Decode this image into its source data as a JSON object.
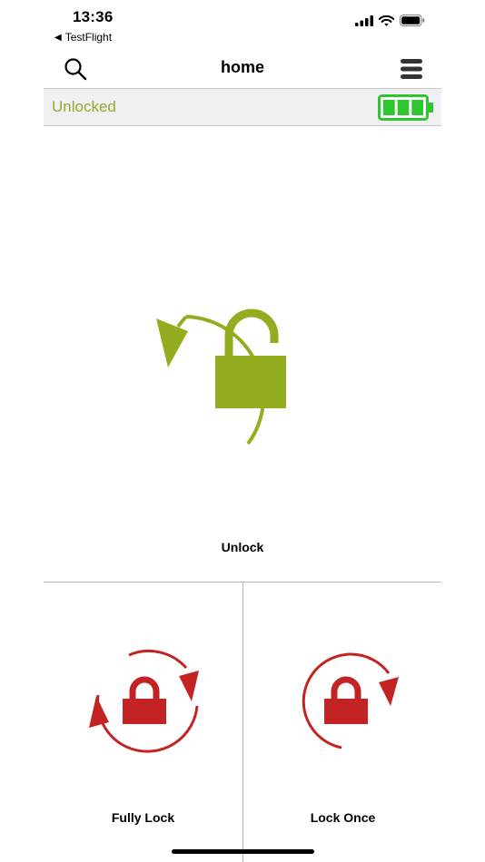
{
  "status_bar": {
    "time": "13:36",
    "back_app": "TestFlight",
    "back_glyph": "◀",
    "icons": [
      "cellular-signal-icon",
      "wifi-icon",
      "battery-icon"
    ]
  },
  "nav": {
    "title": "home",
    "search_icon": "search-icon",
    "menu_icon": "hamburger-menu-icon"
  },
  "lock_state": {
    "label": "Unlocked",
    "color": "#92ad20",
    "battery_level_bars": 3,
    "battery_capacity_bars": 3,
    "battery_color": "#2ec62e"
  },
  "actions": {
    "unlock": {
      "label": "Unlock",
      "icon": "unlock-rotate-icon",
      "color": "#92ad20"
    },
    "fully_lock": {
      "label": "Fully Lock",
      "icon": "lock-double-rotate-icon",
      "color": "#c42323"
    },
    "lock_once": {
      "label": "Lock Once",
      "icon": "lock-once-rotate-icon",
      "color": "#c42323"
    }
  }
}
